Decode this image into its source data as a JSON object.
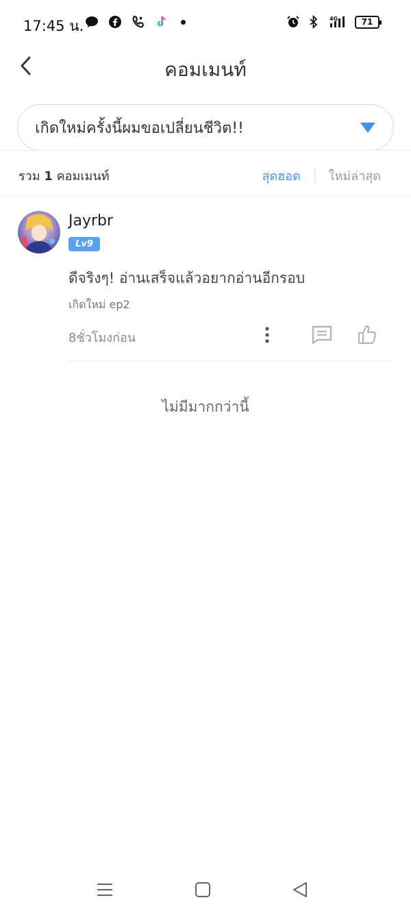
{
  "status_bar": {
    "time": "17:45 น.",
    "left_icons": [
      "messenger-icon",
      "facebook-icon",
      "phone-call-icon",
      "tiktok-icon",
      "dot-icon"
    ],
    "right_icons": [
      "alarm-icon",
      "bluetooth-icon",
      "signal-4g-icon"
    ],
    "battery": "71"
  },
  "header": {
    "title": "คอมเมนท์",
    "back_icon": "chevron-left-icon"
  },
  "book_selector": {
    "title": "เกิดใหม่ครั้งนี้ผมขอเปลี่ยนชีวิต!!",
    "arrow_icon": "triangle-down-icon",
    "arrow_color": "#4a90e2"
  },
  "summary": {
    "prefix": "รวม",
    "count": "1",
    "suffix": "คอมเมนท์"
  },
  "sort": {
    "hot_label": "สุดฮอต",
    "new_label": "ใหม่ล่าสุด",
    "active": "hot",
    "active_color": "#4a90e2"
  },
  "comments": [
    {
      "username": "Jayrbr",
      "level": "Lv9",
      "text": "ดีจริงๆ! อ่านเสร็จแล้วอยากอ่านอีกรอบ",
      "chapter": "เกิดใหม่ ep2",
      "time": "8ชั่วโมงก่อน"
    }
  ],
  "footer": {
    "no_more": "ไม่มีมากกว่านี้"
  },
  "nav_bar": {
    "icons": [
      "menu-icon",
      "home-square-icon",
      "back-triangle-icon"
    ]
  }
}
